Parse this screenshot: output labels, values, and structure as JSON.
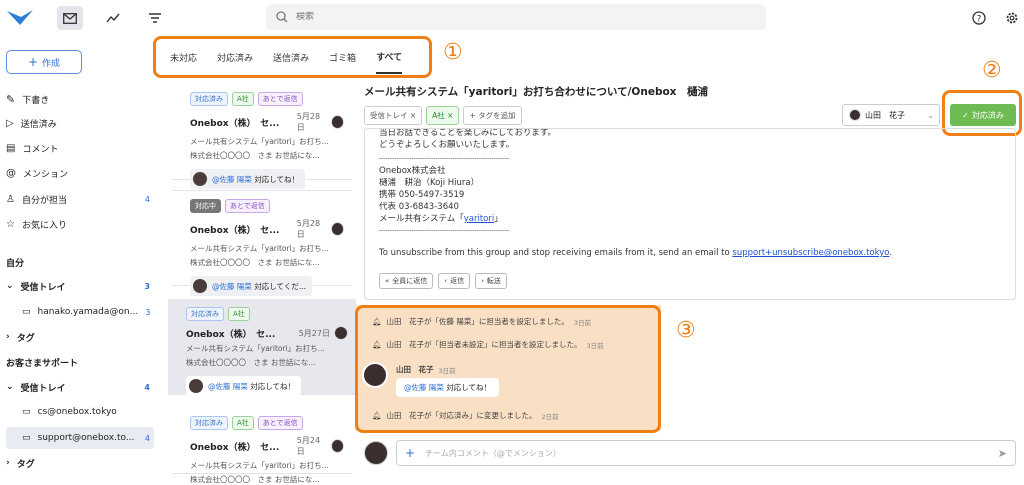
{
  "search": {
    "placeholder": "検索"
  },
  "sidebar": {
    "compose_label": "作成",
    "nav": [
      {
        "label": "下書き",
        "count": ""
      },
      {
        "label": "送信済み",
        "count": ""
      },
      {
        "label": "コメント",
        "count": ""
      },
      {
        "label": "メンション",
        "count": ""
      },
      {
        "label": "自分が担当",
        "count": "4"
      },
      {
        "label": "お気に入り",
        "count": ""
      }
    ],
    "section1": "自分",
    "inbox1": {
      "label": "受信トレイ",
      "count": "3"
    },
    "account1": {
      "label": "hanako.yamada@on...",
      "count": "3"
    },
    "tags1": "タグ",
    "section2": "お客さまサポート",
    "inbox2": {
      "label": "受信トレイ",
      "count": "4"
    },
    "account2": {
      "label": "cs@onebox.tokyo",
      "count": ""
    },
    "account3": {
      "label": "support@onebox.to...",
      "count": "4"
    },
    "tags2": "タグ"
  },
  "tabs": [
    "未対応",
    "対応済み",
    "送信済み",
    "ゴミ箱",
    "すべて"
  ],
  "annotations": [
    "①",
    "②",
    "③"
  ],
  "list": [
    {
      "badges": [
        {
          "t": "対応済み",
          "c": "blue"
        },
        {
          "t": "A社",
          "c": "green"
        },
        {
          "t": "あとで返信",
          "c": "purple"
        }
      ],
      "name": "Onebox（株）　セ...",
      "date": "5月28日",
      "line1": "メール共有システム「yaritori」お打ち...",
      "line2": "株式会社〇〇〇〇　さま お世話にな...",
      "mention_at": "@佐藤 陽菜",
      "mention_text": " 対応してね！"
    },
    {
      "badges": [
        {
          "t": "対応中",
          "c": "dark"
        },
        {
          "t": "あとで返信",
          "c": "purple"
        }
      ],
      "name": "Onebox（株）　セ...",
      "date": "5月28日",
      "line1": "メール共有システム「yaritori」お打ち...",
      "line2": "株式会社〇〇〇〇　さま お世話にな...",
      "mention_at": "@佐藤 陽菜",
      "mention_text": " 対応してくだ..."
    },
    {
      "badges": [
        {
          "t": "対応済み",
          "c": "blue"
        },
        {
          "t": "A社",
          "c": "green"
        }
      ],
      "name": "Onebox（株）　セ...",
      "date": "5月27日",
      "line1": "メール共有システム「yaritori」お打ち...",
      "line2": "株式会社〇〇〇〇　さま お世話にな...",
      "mention_at": "@佐藤 陽菜",
      "mention_text": " 対応してね！"
    },
    {
      "badges": [
        {
          "t": "対応済み",
          "c": "blue"
        },
        {
          "t": "A社",
          "c": "green"
        },
        {
          "t": "あとで返信",
          "c": "purple"
        }
      ],
      "name": "Onebox（株）　セ...",
      "date": "5月24日",
      "line1": "メール共有システム「yaritori」お打ち...",
      "line2": "株式会社〇〇〇〇　さま お世話にな...",
      "mention_at": "",
      "mention_text": ""
    }
  ],
  "mail": {
    "title": "メール共有システム「yaritori」お打ち合わせについて/Onebox　樋浦",
    "chip_inbox": "受信トレイ ×",
    "chip_tag": "A社 ×",
    "chip_add": "タグを追加",
    "assignee": "山田　花子",
    "done_button": "対応済み",
    "body": [
      "当日お話できることを楽しみにしております。",
      "どうぞよろしくお願いいたします。",
      "------------------------------------------------------------",
      "Onebox株式会社",
      "樋浦　耕治（Koji Hiura）",
      "携帯 050-5497-3519",
      "代表 03-6843-3640"
    ],
    "sig_prefix": "メール共有システム「",
    "sig_link": "yaritori",
    "sig_suffix": "」",
    "sig_rule": "------------------------------------------------------------",
    "unsub_text": "To unsubscribe from this group and stop receiving emails from it, send an email to ",
    "unsub_link": "support+unsubscribe@onebox.tokyo",
    "unsub_end": ".",
    "reply_all": "全員に返信",
    "reply": "返信",
    "forward": "転送"
  },
  "activity": [
    {
      "text": "山田　花子が「佐藤 陽菜」に担当者を設定しました。",
      "time": "3日前"
    },
    {
      "text": "山田　花子が「担当者未設定」に担当者を設定しました。",
      "time": "3日前"
    },
    {
      "text": "山田　花子が「対応済み」に変更しました。",
      "time": "2日前"
    }
  ],
  "comment_item": {
    "author": "山田　花子",
    "time": "3日前",
    "at": "@佐藤 陽菜",
    "text": " 対応してね！"
  },
  "comment_input": {
    "placeholder": "チーム内コメント（@でメンション）"
  }
}
